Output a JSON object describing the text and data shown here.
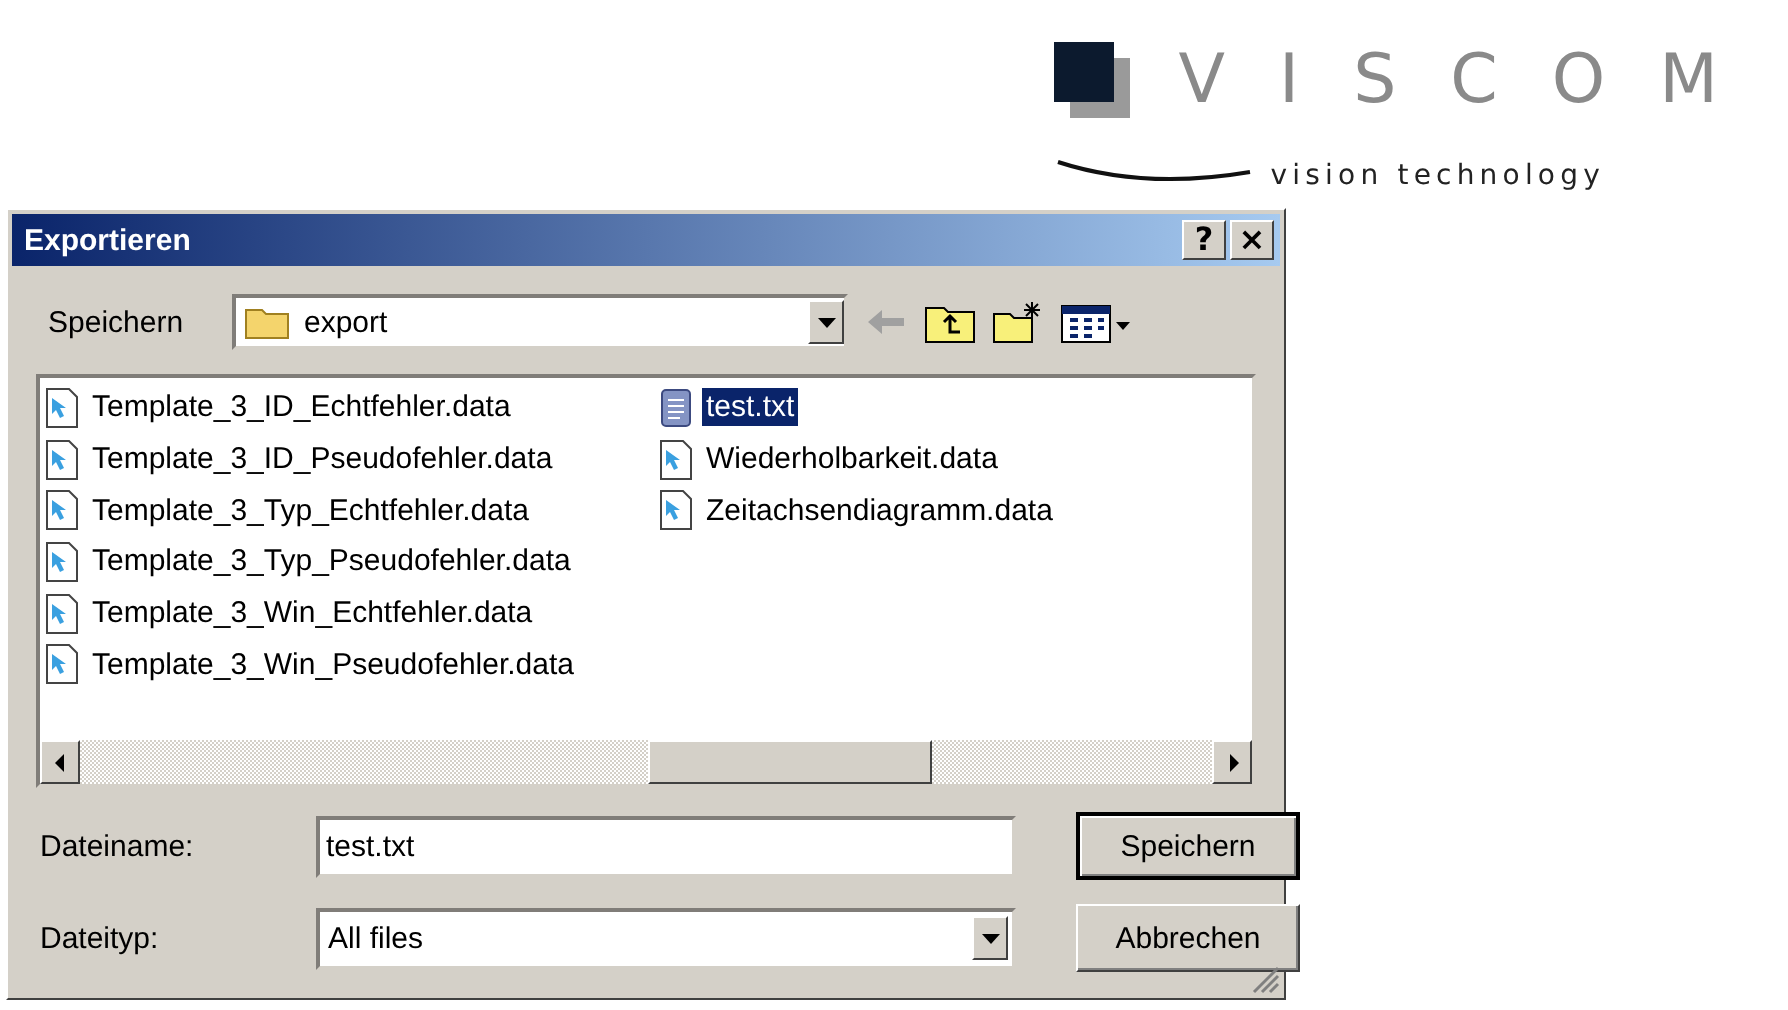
{
  "logo": {
    "name": "VISCOM",
    "tagline": "vision technology"
  },
  "window": {
    "title": "Exportieren",
    "help_button": "?",
    "close_button": "×"
  },
  "save_in": {
    "label": "Speichern",
    "folder": "export"
  },
  "files": [
    {
      "name": "Template_3_ID_Echtfehler.data",
      "kind": "data",
      "selected": false
    },
    {
      "name": "Template_3_ID_Pseudofehler.data",
      "kind": "data",
      "selected": false
    },
    {
      "name": "Template_3_Typ_Echtfehler.data",
      "kind": "data",
      "selected": false
    },
    {
      "name": "Template_3_Typ_Pseudofehler.data",
      "kind": "data",
      "selected": false
    },
    {
      "name": "Template_3_Win_Echtfehler.data",
      "kind": "data",
      "selected": false
    },
    {
      "name": "Template_3_Win_Pseudofehler.data",
      "kind": "data",
      "selected": false
    },
    {
      "name": "test.txt",
      "kind": "text",
      "selected": true
    },
    {
      "name": "Wiederholbarkeit.data",
      "kind": "data",
      "selected": false
    },
    {
      "name": "Zeitachsendiagramm.data",
      "kind": "data",
      "selected": false
    }
  ],
  "file_name": {
    "label": "Dateiname:",
    "value": "test.txt"
  },
  "file_type": {
    "label": "Dateityp:",
    "value": "All files"
  },
  "buttons": [
    {
      "label": "Speichern",
      "default": true
    },
    {
      "label": "Abbrechen",
      "default": false
    }
  ]
}
